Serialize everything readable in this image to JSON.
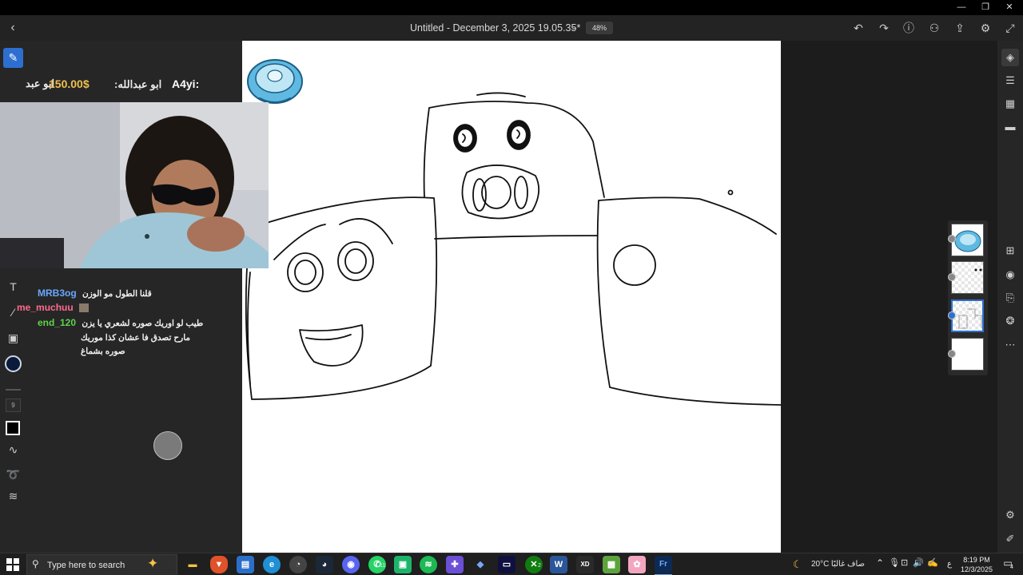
{
  "window": {
    "minimize_glyph": "—",
    "maximize_glyph": "❐",
    "close_glyph": "✕"
  },
  "header": {
    "title": "Untitled - December 3, 2025 19.05.35*",
    "zoom": "48%",
    "icons": [
      "back-icon",
      "chevron-down-icon",
      "undo-icon",
      "redo-icon",
      "help-icon",
      "share-user-icon",
      "export-icon",
      "settings-icon",
      "fullscreen-icon"
    ]
  },
  "left_tools": {
    "active": "pencil-brush",
    "brush_size": "9",
    "color_hex": "#0b1a3a",
    "icons": [
      "brush-icon",
      "text-icon",
      "eyedropper-icon",
      "image-icon",
      "color-icon",
      "shape-icon",
      "stroke-smooth-icon",
      "lasso-icon",
      "adjust-icon"
    ]
  },
  "overlay": {
    "donation": {
      "donor_cut": "ابو عبد",
      "amount": "150.00$",
      "donor_name": "ابو عبدالله:",
      "user": "A4yi:"
    },
    "chat": [
      {
        "user": "MRB3og",
        "user_color": "#6aa8ff",
        "message": "قلنا الطول مو الوزن"
      },
      {
        "user": "me_muchuu",
        "user_color": "#ff6b8e",
        "message": ""
      },
      {
        "user": "end_120",
        "user_color": "#5fd34a",
        "message": "طيب لو اوريك صوره لشعري يا يزن"
      },
      {
        "user": "",
        "user_color": "#5fd34a",
        "message": "مارح تصدق فا عشان كذا موريك"
      },
      {
        "user": "",
        "user_color": "#5fd34a",
        "message": "صوره بشماغ"
      }
    ]
  },
  "layers": [
    {
      "name": "pacifier-layer",
      "selected": false
    },
    {
      "name": "eyes-layer",
      "selected": false
    },
    {
      "name": "sketch-layer",
      "selected": true
    },
    {
      "name": "background-layer",
      "selected": false
    }
  ],
  "right_tools": {
    "icons": [
      "layers-icon",
      "adjustments-icon",
      "grid-icon",
      "comment-icon",
      "add-layer-icon",
      "visibility-icon",
      "import-icon",
      "blend-icon",
      "more-icon",
      "properties-icon",
      "ruler-icon"
    ]
  },
  "taskbar": {
    "search_placeholder": "Type here to search",
    "weather_temp": "20°C",
    "weather_text": "صاف غالبًا",
    "keyboard_lang": "ع",
    "time": "8:19 PM",
    "date": "12/3/2025",
    "notification_count": "4",
    "whatsapp_badge": "11",
    "xbox_badge": "2",
    "apps": [
      "file-explorer",
      "brave",
      "store",
      "edge",
      "clock-app",
      "steam",
      "discord-app",
      "whatsapp",
      "game-app",
      "spotify",
      "gamepad-app",
      "vpn-app",
      "terminal-app",
      "xbox",
      "word",
      "xd-app",
      "minecraft",
      "pink-app",
      "fresco"
    ]
  }
}
